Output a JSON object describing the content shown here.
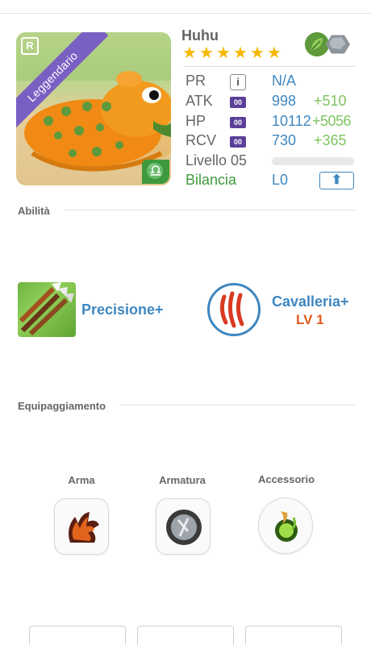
{
  "hero": {
    "name": "Huhu",
    "rarity": "Leggendario",
    "rank_badge": "R",
    "stars": 6,
    "elements": [
      "leaf-icon",
      "rock-icon"
    ],
    "zodiac_symbol": "♎"
  },
  "stats": {
    "pr": {
      "label": "PR",
      "value": "N/A"
    },
    "atk": {
      "label": "ATK",
      "chip": "00",
      "value": "998",
      "bonus": "+510"
    },
    "hp": {
      "label": "HP",
      "chip": "00",
      "value": "10112",
      "bonus": "+5056"
    },
    "rcv": {
      "label": "RCV",
      "chip": "00",
      "value": "730",
      "bonus": "+365"
    },
    "level": {
      "label": "Livello 05",
      "progress": 0
    },
    "zodiac": {
      "label": "Bilancia",
      "value": "L0"
    }
  },
  "colors": {
    "accent_blue": "#3f87c0",
    "bonus_green": "#7fc45f",
    "zodiac_green": "#3f9a3d",
    "rarity_purple": "#7a5fc3",
    "skill_level_orange": "#e25a1d"
  },
  "abilities": {
    "title": "Abilità",
    "skills": [
      {
        "name": "Precisione+",
        "icon": "arrows-icon"
      },
      {
        "name": "Cavalleria+",
        "level": "LV 1",
        "icon": "claw-marks-icon"
      }
    ]
  },
  "equipment": {
    "title": "Equipaggiamento",
    "slots": [
      {
        "label": "Arma",
        "icon": "claw-weapon-icon"
      },
      {
        "label": "Armatura",
        "icon": "shield-armor-icon"
      },
      {
        "label": "Accessorio",
        "icon": "green-orb-accessory-icon"
      }
    ]
  },
  "upgrade_icon": "arrow-up-icon"
}
